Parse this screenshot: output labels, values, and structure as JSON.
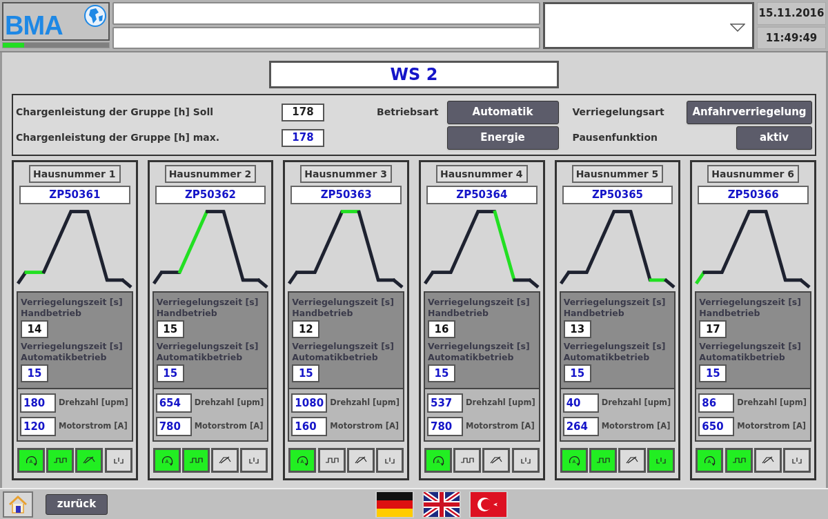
{
  "header": {
    "logo": "BMA",
    "progress": {
      "level": 0.2
    },
    "date": "15.11.2016",
    "time": "11:49:49"
  },
  "title": "WS 2",
  "settings": {
    "soll_label": "Chargenleistung der Gruppe [h] Soll",
    "soll_value": "178",
    "max_label": "Chargenleistung der Gruppe [h] max.",
    "max_value": "178",
    "betriebsart_label": "Betriebsart",
    "betriebsart_button": "Automatik",
    "energie_button": "Energie",
    "verriegelungsart_label": "Verriegelungsart",
    "verriegelungsart_button": "Anfahrverriegelung",
    "pausenfunktion_label": "Pausenfunktion",
    "pausenfunktion_button": "aktiv"
  },
  "units": [
    {
      "house": "Hausnummer 1",
      "id": "ZP50361",
      "profile": [
        {
          "active": false
        },
        {
          "active": true
        },
        {
          "active": false
        },
        {
          "active": false
        },
        {
          "active": false
        },
        {
          "active": false
        },
        {
          "active": false
        }
      ],
      "hand_label": "Verriegelungszeit [s] Handbetrieb",
      "hand_value": "14",
      "auto_label": "Verriegelungszeit [s] Automatikbetrieb",
      "auto_value": "15",
      "speed_value": "180",
      "speed_label": "Drehzahl [upm]",
      "current_value": "120",
      "current_label": "Motorstrom [A]",
      "status": [
        {
          "kind": "rotation",
          "label": "A",
          "on": true
        },
        {
          "kind": "pulse",
          "on": true
        },
        {
          "kind": "slope",
          "on": true
        },
        {
          "kind": "lock",
          "on": false
        }
      ]
    },
    {
      "house": "Hausnummer 2",
      "id": "ZP50362",
      "profile": [
        {
          "active": false
        },
        {
          "active": false
        },
        {
          "active": true
        },
        {
          "active": false
        },
        {
          "active": false
        },
        {
          "active": false
        },
        {
          "active": false
        }
      ],
      "hand_label": "Verriegelungszeit [s] Handbetrieb",
      "hand_value": "15",
      "auto_label": "Verriegelungszeit [s] Automatikbetrieb",
      "auto_value": "15",
      "speed_value": "654",
      "speed_label": "Drehzahl [upm]",
      "current_value": "780",
      "current_label": "Motorstrom [A]",
      "status": [
        {
          "kind": "rotation",
          "label": "A",
          "on": true
        },
        {
          "kind": "pulse",
          "on": true
        },
        {
          "kind": "slope",
          "on": false
        },
        {
          "kind": "lock",
          "on": false
        }
      ]
    },
    {
      "house": "Hausnummer 3",
      "id": "ZP50363",
      "profile": [
        {
          "active": false
        },
        {
          "active": false
        },
        {
          "active": false
        },
        {
          "active": true
        },
        {
          "active": false
        },
        {
          "active": false
        },
        {
          "active": false
        }
      ],
      "hand_label": "Verriegelungszeit [s] Handbetrieb",
      "hand_value": "12",
      "auto_label": "Verriegelungszeit [s] Automatikbetrieb",
      "auto_value": "15",
      "speed_value": "1080",
      "speed_label": "Drehzahl [upm]",
      "current_value": "160",
      "current_label": "Motorstrom [A]",
      "status": [
        {
          "kind": "rotation",
          "label": "A",
          "on": true
        },
        {
          "kind": "pulse",
          "on": false
        },
        {
          "kind": "slope",
          "on": false
        },
        {
          "kind": "lock",
          "on": false
        }
      ]
    },
    {
      "house": "Hausnummer 4",
      "id": "ZP50364",
      "profile": [
        {
          "active": false
        },
        {
          "active": false
        },
        {
          "active": false
        },
        {
          "active": false
        },
        {
          "active": true
        },
        {
          "active": false
        },
        {
          "active": false
        }
      ],
      "hand_label": "Verriegelungszeit [s] Handbetrieb",
      "hand_value": "16",
      "auto_label": "Verriegelungszeit [s] Automatikbetrieb",
      "auto_value": "15",
      "speed_value": "537",
      "speed_label": "Drehzahl [upm]",
      "current_value": "780",
      "current_label": "Motorstrom [A]",
      "status": [
        {
          "kind": "rotation",
          "label": "A",
          "on": true
        },
        {
          "kind": "pulse",
          "on": false
        },
        {
          "kind": "slope",
          "on": false
        },
        {
          "kind": "lock",
          "on": false
        }
      ]
    },
    {
      "house": "Hausnummer 5",
      "id": "ZP50365",
      "profile": [
        {
          "active": false
        },
        {
          "active": false
        },
        {
          "active": false
        },
        {
          "active": false
        },
        {
          "active": false
        },
        {
          "active": true
        },
        {
          "active": false
        }
      ],
      "hand_label": "Verriegelungszeit [s] Handbetrieb",
      "hand_value": "13",
      "auto_label": "Verriegelungszeit [s] Automatikbetrieb",
      "auto_value": "15",
      "speed_value": "40",
      "speed_label": "Drehzahl [upm]",
      "current_value": "264",
      "current_label": "Motorstrom [A]",
      "status": [
        {
          "kind": "rotation",
          "label": "A",
          "on": true
        },
        {
          "kind": "pulse",
          "on": true
        },
        {
          "kind": "slope",
          "on": false
        },
        {
          "kind": "lock",
          "on": true
        }
      ]
    },
    {
      "house": "Hausnummer 6",
      "id": "ZP50366",
      "profile": [
        {
          "active": true
        },
        {
          "active": false
        },
        {
          "active": false
        },
        {
          "active": false
        },
        {
          "active": false
        },
        {
          "active": false
        },
        {
          "active": false
        }
      ],
      "hand_label": "Verriegelungszeit [s] Handbetrieb",
      "hand_value": "17",
      "auto_label": "Verriegelungszeit [s] Automatikbetrieb",
      "auto_value": "15",
      "speed_value": "86",
      "speed_label": "Drehzahl [upm]",
      "current_value": "650",
      "current_label": "Motorstrom [A]",
      "status": [
        {
          "kind": "rotation",
          "label": "A",
          "on": true
        },
        {
          "kind": "pulse",
          "on": true
        },
        {
          "kind": "slope",
          "on": false
        },
        {
          "kind": "lock",
          "on": false
        }
      ]
    }
  ],
  "footer": {
    "back_button": "zurück",
    "languages": [
      {
        "kind": "de"
      },
      {
        "kind": "en"
      },
      {
        "kind": "tr"
      }
    ]
  }
}
